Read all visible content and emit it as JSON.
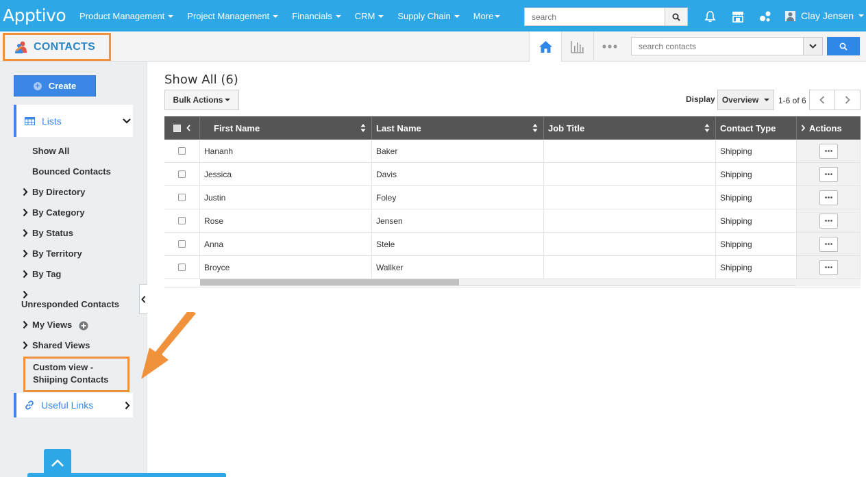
{
  "app": {
    "logo": "Apptivo"
  },
  "topnav": {
    "items": [
      {
        "label": "Product Management",
        "has_caret": true
      },
      {
        "label": "Project Management",
        "has_caret": true
      },
      {
        "label": "Financials",
        "has_caret": true
      },
      {
        "label": "CRM",
        "has_caret": true
      },
      {
        "label": "Supply Chain",
        "has_caret": true
      },
      {
        "label": "More",
        "has_caret": true
      }
    ],
    "search_placeholder": "search",
    "user_name": "Clay Jensen"
  },
  "subbar": {
    "title": "CONTACTS",
    "search_placeholder": "search contacts"
  },
  "sidebar": {
    "create_label": "Create",
    "lists_label": "Lists",
    "items": [
      {
        "label": "Show All"
      },
      {
        "label": "Bounced Contacts"
      },
      {
        "label": "By Directory"
      },
      {
        "label": "By Category"
      },
      {
        "label": "By Status"
      },
      {
        "label": "By Territory"
      },
      {
        "label": "By Tag"
      },
      {
        "label": "Unresponded Contacts"
      },
      {
        "label": "My Views"
      },
      {
        "label": "Shared Views"
      }
    ],
    "custom_view": {
      "line1": "Custom view -",
      "line2": "Shiiping Contacts"
    },
    "useful_links_label": "Useful Links"
  },
  "main": {
    "heading": "Show All (6)",
    "bulk_actions_label": "Bulk Actions",
    "display_label": "Display",
    "view_mode": "Overview",
    "page_info": "1-6 of 6",
    "columns": [
      "First Name",
      "Last Name",
      "Job Title",
      "Contact Type",
      "Actions"
    ],
    "rows": [
      {
        "first": "Hananh",
        "last": "Baker",
        "job": "",
        "type": "Shipping"
      },
      {
        "first": "Jessica",
        "last": "Davis",
        "job": "",
        "type": "Shipping"
      },
      {
        "first": "Justin",
        "last": "Foley",
        "job": "",
        "type": "Shipping"
      },
      {
        "first": "Rose",
        "last": "Jensen",
        "job": "",
        "type": "Shipping"
      },
      {
        "first": "Anna",
        "last": "Stele",
        "job": "",
        "type": "Shipping"
      },
      {
        "first": "Broyce",
        "last": "Wallker",
        "job": "",
        "type": "Shipping"
      }
    ]
  },
  "colors": {
    "topbar": "#2da7e6",
    "accent": "#3a87e5",
    "highlight": "#f0923b",
    "grid_header": "#555555"
  }
}
